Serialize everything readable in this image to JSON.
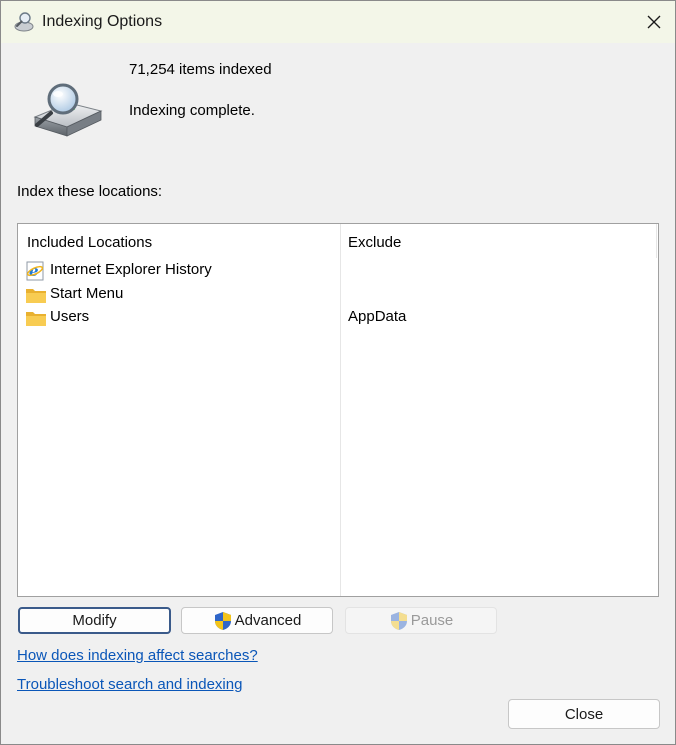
{
  "window": {
    "title": "Indexing Options",
    "close_glyph": "✕"
  },
  "status": {
    "items_indexed": "71,254 items indexed",
    "state": "Indexing complete."
  },
  "locations": {
    "label": "Index these locations:",
    "columns": {
      "included": "Included Locations",
      "exclude": "Exclude"
    },
    "rows": [
      {
        "name": "Internet Explorer History",
        "exclude": "",
        "icon": "internet-explorer-icon"
      },
      {
        "name": "Start Menu",
        "exclude": "",
        "icon": "folder-icon"
      },
      {
        "name": "Users",
        "exclude": "AppData",
        "icon": "folder-icon"
      }
    ]
  },
  "buttons": {
    "modify": "Modify",
    "advanced": "Advanced",
    "pause": "Pause",
    "close": "Close"
  },
  "links": {
    "how_affects": "How does indexing affect searches?",
    "troubleshoot": "Troubleshoot search and indexing"
  },
  "colors": {
    "titlebar": "#f3f6e8",
    "link": "#0a56b8",
    "folder": "#f5c346",
    "shield_blue": "#2f66c9",
    "shield_yellow": "#f3c41a"
  }
}
